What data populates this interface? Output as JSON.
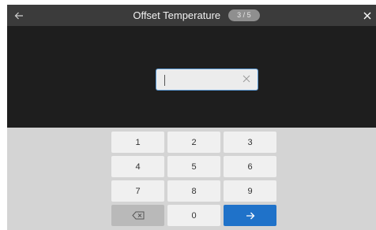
{
  "header": {
    "title": "Offset Temperature",
    "step": "3 / 5",
    "back_icon": "arrow-left-icon",
    "close_icon": "close-icon"
  },
  "input": {
    "value": "",
    "clear_icon": "close-icon"
  },
  "keypad": {
    "keys": [
      "1",
      "2",
      "3",
      "4",
      "5",
      "6",
      "7",
      "8",
      "9"
    ],
    "zero": "0",
    "backspace_icon": "backspace-icon",
    "enter_icon": "arrow-right-icon"
  },
  "colors": {
    "header_bg": "#3b3b3b",
    "entry_bg": "#1e1e1e",
    "keypad_bg": "#d4d4d4",
    "accent": "#1f72c9"
  }
}
